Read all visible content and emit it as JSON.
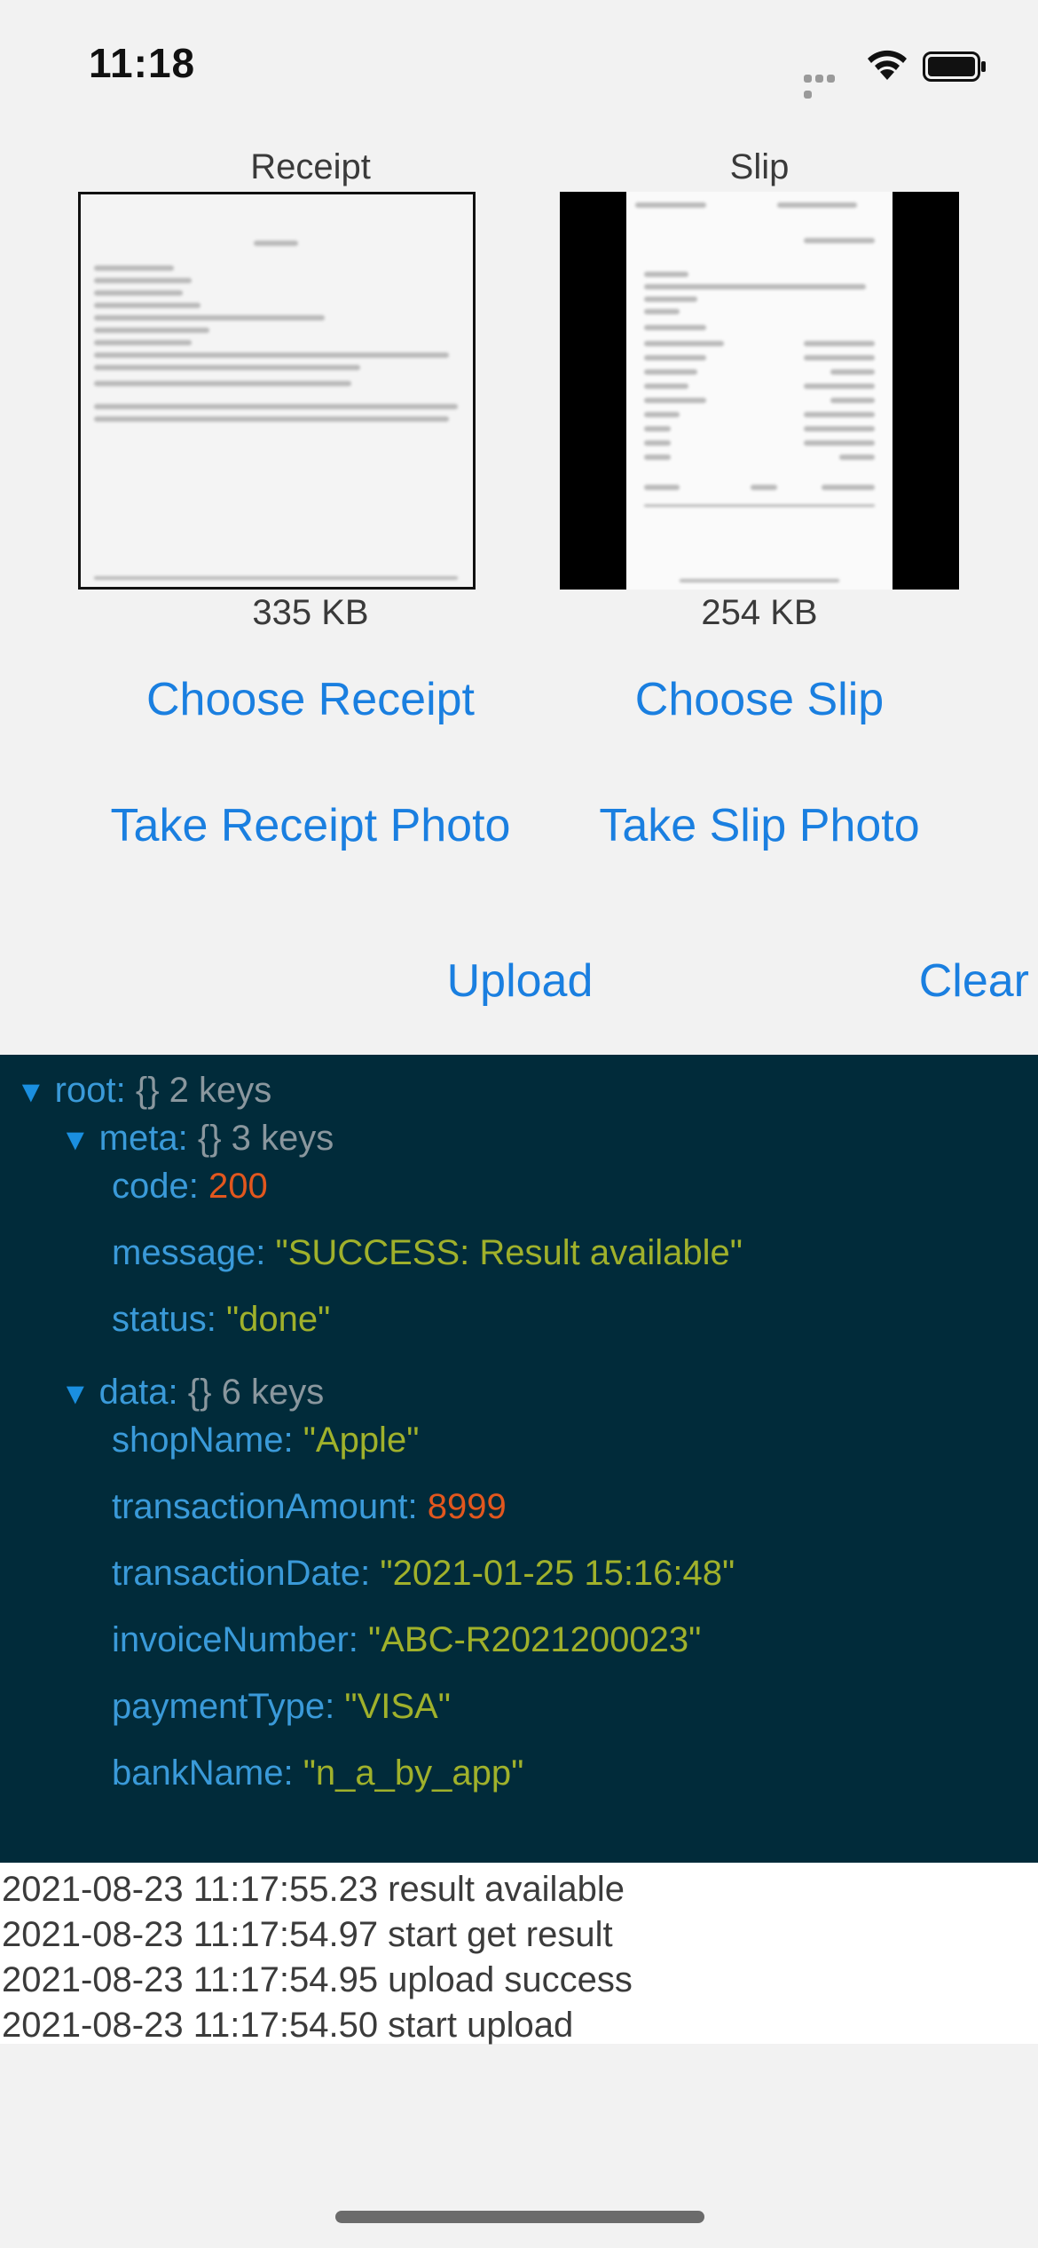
{
  "status_bar": {
    "time": "11:18",
    "icons": [
      "cellular-signal-icon",
      "wifi-icon",
      "battery-icon"
    ]
  },
  "receipt": {
    "label": "Receipt",
    "size": "335 KB",
    "choose_label": "Choose Receipt",
    "photo_label": "Take Receipt Photo"
  },
  "slip": {
    "label": "Slip",
    "size": "254 KB",
    "choose_label": "Choose Slip",
    "photo_label": "Take Slip Photo"
  },
  "actions": {
    "upload_label": "Upload",
    "clear_label": "Clear"
  },
  "json_view": {
    "root": {
      "key": "root:",
      "meta": "{} 2 keys"
    },
    "meta": {
      "key": "meta:",
      "meta_info": "{} 3 keys",
      "code_key": "code:",
      "code_value": "200",
      "message_key": "message:",
      "message_value": "\"SUCCESS: Result available\"",
      "status_key": "status:",
      "status_value": "\"done\""
    },
    "data": {
      "key": "data:",
      "meta_info": "{} 6 keys",
      "shopName_key": "shopName:",
      "shopName_value": "\"Apple\"",
      "transactionAmount_key": "transactionAmount:",
      "transactionAmount_value": "8999",
      "transactionDate_key": "transactionDate:",
      "transactionDate_value": "\"2021-01-25 15:16:48\"",
      "invoiceNumber_key": "invoiceNumber:",
      "invoiceNumber_value": "\"ABC-R2021200023\"",
      "paymentType_key": "paymentType:",
      "paymentType_value": "\"VISA\"",
      "bankName_key": "bankName:",
      "bankName_value": "\"n_a_by_app\""
    },
    "expand_glyph": "▼"
  },
  "log": [
    "2021-08-23 11:17:55.23 result available",
    "2021-08-23 11:17:54.97 start get result",
    "2021-08-23 11:17:54.95 upload success",
    "2021-08-23 11:17:54.50 start upload"
  ],
  "colors": {
    "accent": "#1a7fe0",
    "json_background": "#012b3a",
    "json_key": "#3a9ad9",
    "json_number": "#e2571e",
    "json_string": "#a0b12b"
  }
}
